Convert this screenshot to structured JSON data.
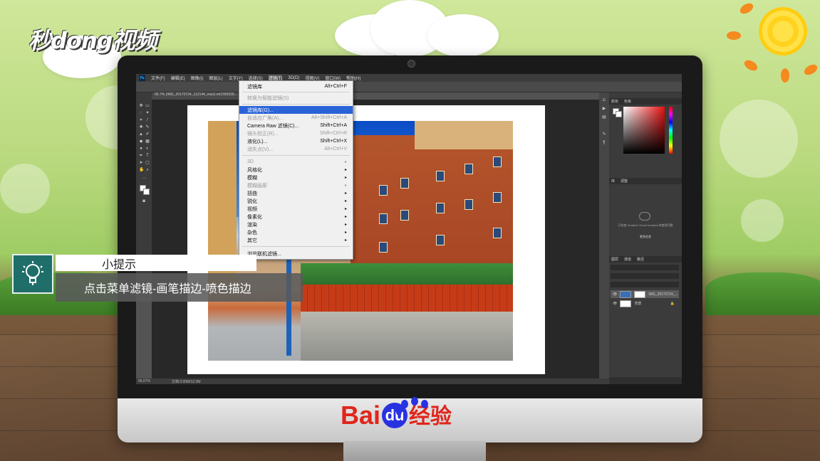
{
  "watermark": {
    "logo_text": "秒dong视频"
  },
  "brand": {
    "bai": "Bai",
    "du": "du",
    "jingyan": "经验"
  },
  "photoshop": {
    "app_icon": "Ps",
    "menubar": [
      "文件(F)",
      "编辑(E)",
      "图像(I)",
      "图层(L)",
      "文字(Y)",
      "选择(S)",
      "滤镜(T)",
      "3D(D)",
      "视图(V)",
      "窗口(W)",
      "帮助(H)"
    ],
    "doc_tab": "66.7% (IMG_20170724_112144_miui1.mi1555039...",
    "status": {
      "zoom": "66.67%",
      "doc": "文档:3.00M/12.0M"
    },
    "panels": {
      "color_tabs": [
        "颜色",
        "色板"
      ],
      "library_tabs": [
        "库",
        "调整"
      ],
      "library_text": "已检查 Creative Cloud Libraries 的使用问题",
      "library_link": "更多信息",
      "layers_tabs": [
        "图层",
        "通道",
        "路径"
      ],
      "layers": [
        {
          "name": "IMG_20170724_..."
        },
        {
          "name": "背景"
        }
      ]
    },
    "filter_menu": {
      "items": [
        {
          "label": "滤镜库",
          "shortcut": "Alt+Ctrl+F",
          "state": "normal"
        },
        {
          "label": "转换为智能滤镜(S)",
          "shortcut": "",
          "state": "disabled"
        },
        {
          "label": "滤镜库(G)...",
          "shortcut": "",
          "state": "highlight"
        },
        {
          "label": "自适应广角(A)...",
          "shortcut": "Alt+Shift+Ctrl+A",
          "state": "disabled"
        },
        {
          "label": "Camera Raw 滤镜(C)...",
          "shortcut": "Shift+Ctrl+A",
          "state": "normal"
        },
        {
          "label": "镜头校正(R)...",
          "shortcut": "Shift+Ctrl+R",
          "state": "disabled"
        },
        {
          "label": "液化(L)...",
          "shortcut": "Shift+Ctrl+X",
          "state": "normal"
        },
        {
          "label": "消失点(V)...",
          "shortcut": "Alt+Ctrl+V",
          "state": "disabled"
        },
        {
          "label": "3D",
          "shortcut": "",
          "state": "disabled",
          "submenu": true
        },
        {
          "label": "风格化",
          "shortcut": "",
          "state": "normal",
          "submenu": true
        },
        {
          "label": "模糊",
          "shortcut": "",
          "state": "normal",
          "submenu": true
        },
        {
          "label": "模糊画廊",
          "shortcut": "",
          "state": "disabled",
          "submenu": true
        },
        {
          "label": "扭曲",
          "shortcut": "",
          "state": "normal",
          "submenu": true
        },
        {
          "label": "锐化",
          "shortcut": "",
          "state": "normal",
          "submenu": true
        },
        {
          "label": "视频",
          "shortcut": "",
          "state": "normal",
          "submenu": true
        },
        {
          "label": "像素化",
          "shortcut": "",
          "state": "normal",
          "submenu": true
        },
        {
          "label": "渲染",
          "shortcut": "",
          "state": "normal",
          "submenu": true
        },
        {
          "label": "杂色",
          "shortcut": "",
          "state": "normal",
          "submenu": true
        },
        {
          "label": "其它",
          "shortcut": "",
          "state": "normal",
          "submenu": true
        },
        {
          "label": "浏览联机滤镜...",
          "shortcut": "",
          "state": "normal"
        }
      ]
    }
  },
  "tip": {
    "title": "小提示",
    "body": "点击菜单滤镜-画笔描边-喷色描边"
  },
  "colors": {
    "accent": "#2a63d8",
    "tip_teal": "#1f6e6a",
    "brand_red": "#e1251b",
    "brand_blue": "#2932e1"
  }
}
